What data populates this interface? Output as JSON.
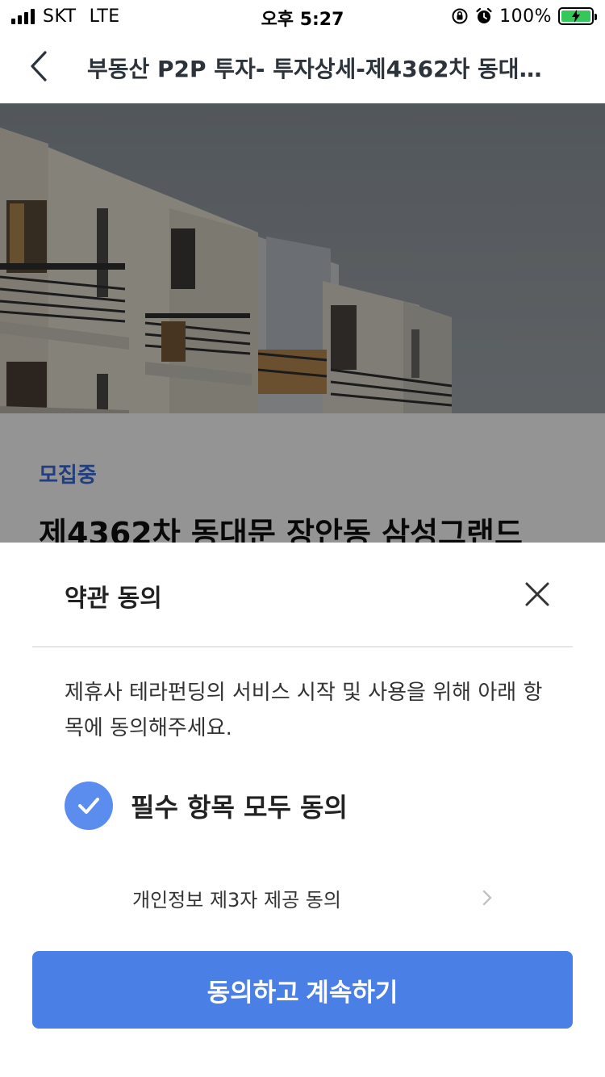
{
  "status_bar": {
    "carrier": "SKT",
    "network": "LTE",
    "time": "오후 5:27",
    "battery": "100%",
    "icons": [
      "signal-icon",
      "orientation-lock-icon",
      "alarm-icon",
      "battery-charging-icon"
    ]
  },
  "nav": {
    "title": "부동산 P2P 투자- 투자상세-제4362차 동대…",
    "back_icon": "chevron-left-icon"
  },
  "page": {
    "badge": "모집중",
    "product_title": "제4362차 동대문 장안동 삼성그랜드"
  },
  "sheet": {
    "title": "약관 동의",
    "close_icon": "close-icon",
    "description": "제휴사 테라펀딩의 서비스 시작 및 사용을 위해 아래 항목에 동의해주세요.",
    "agree_all_label": "필수 항목 모두 동의",
    "agree_all_checked": true,
    "terms": [
      {
        "label": "개인정보 제3자 제공 동의"
      }
    ],
    "cta_label": "동의하고 계속하기"
  },
  "colors": {
    "accent": "#4a7fe6",
    "check": "#5b8def",
    "badge": "#3b6bd6",
    "battery": "#34c759"
  }
}
